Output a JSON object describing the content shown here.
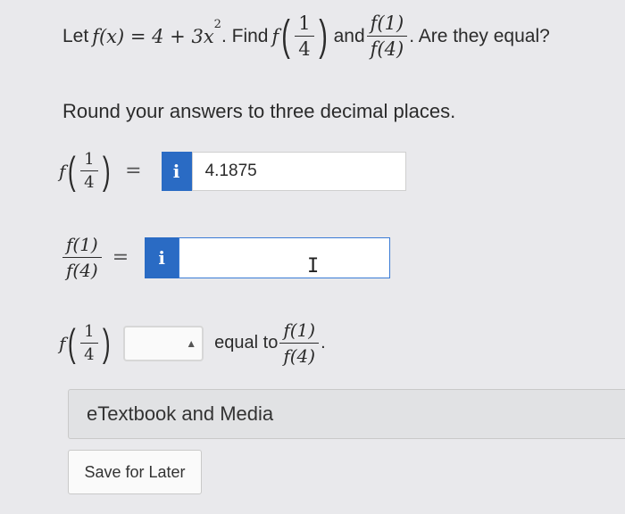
{
  "question": {
    "let_word": "Let",
    "function_def": "f(x) = 4 + 3x",
    "exponent": "2",
    "period_find": ". Find",
    "f_symbol": "f",
    "quarter_num": "1",
    "quarter_den": "4",
    "and_word": "and",
    "ratio_num": "f(1)",
    "ratio_den": "f(4)",
    "tail": ". Are they equal?"
  },
  "instruction": "Round your answers to three decimal places.",
  "row1": {
    "f_symbol": "f",
    "frac_num": "1",
    "frac_den": "4",
    "equals": "=",
    "info_icon": "i",
    "value": "4.1875"
  },
  "row2": {
    "num": "f(1)",
    "den": "f(4)",
    "equals": "=",
    "info_icon": "i",
    "value": ""
  },
  "row3": {
    "f_symbol": "f",
    "frac_num": "1",
    "frac_den": "4",
    "select_value": "",
    "equal_to": "equal to",
    "num": "f(1)",
    "den": "f(4)",
    "period": "."
  },
  "etextbook_label": "eTextbook and Media",
  "save_label": "Save for Later",
  "colors": {
    "info_button": "#2a6bc4",
    "active_border": "#3a7bd5"
  }
}
